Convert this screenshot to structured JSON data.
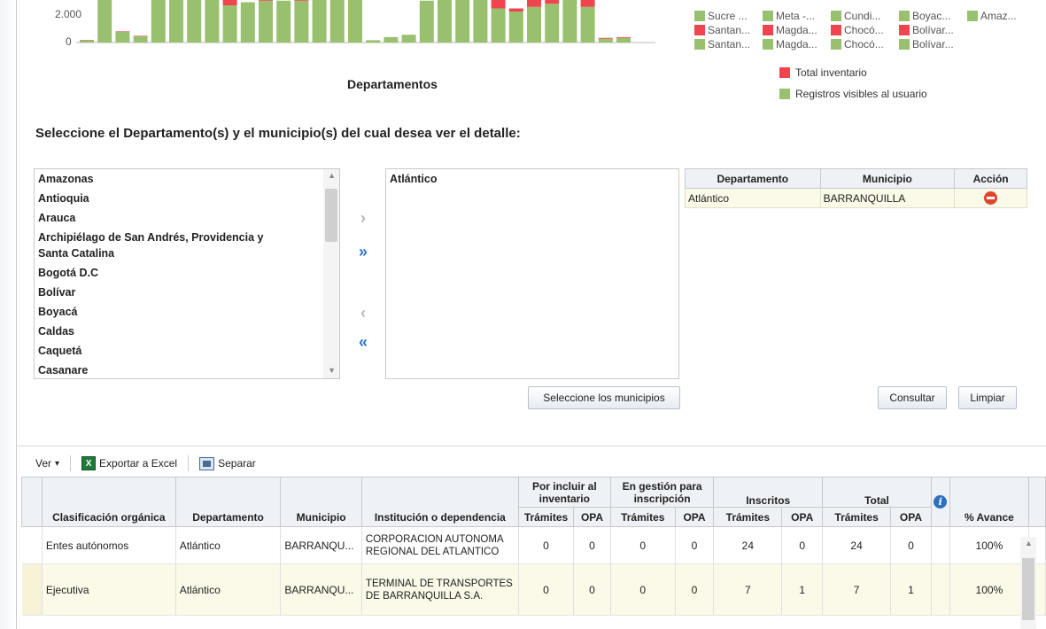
{
  "chart": {
    "y_ticks": [
      "2.000",
      "0"
    ],
    "x_title": "Departamentos",
    "legend_grid": [
      [
        "Sucre ...",
        "Meta -...",
        "Cundi...",
        "Boyac...",
        "Amaz..."
      ],
      [
        "Santan...",
        "Magda...",
        "Chocó...",
        "Bolívar..."
      ],
      [
        "Santan...",
        "Magda...",
        "Chocó...",
        "Bolívar..."
      ]
    ],
    "legend_grid_colors": [
      [
        "#99c06e",
        "#99c06e",
        "#99c06e",
        "#99c06e",
        "#99c06e"
      ],
      [
        "#f0444f",
        "#f0444f",
        "#f0444f",
        "#f0444f"
      ],
      [
        "#99c06e",
        "#99c06e",
        "#99c06e",
        "#99c06e"
      ]
    ],
    "legend_total": "Total inventario",
    "legend_visible": "Registros visibles al usuario",
    "colors": {
      "total": "#f0444f",
      "visible": "#99c06e"
    }
  },
  "chart_data": {
    "type": "bar",
    "title": "",
    "xlabel": "Departamentos",
    "ylabel": "",
    "ylim": [
      0,
      3000
    ],
    "y_ticks": [
      0,
      2000
    ],
    "note": "Stacked bars, top portion of chart is cropped; values estimated",
    "series": [
      {
        "name": "Registros visibles al usuario",
        "values": [
          150,
          3000,
          700,
          400,
          3000,
          3000,
          3000,
          3000,
          2400,
          2600,
          2700,
          2700,
          2700,
          2800,
          3000,
          2800,
          150,
          350,
          500,
          2700,
          3000,
          2900,
          3000,
          2200,
          2000,
          2300,
          2500,
          3000,
          2300,
          250,
          300
        ]
      },
      {
        "name": "Total inventario",
        "values": [
          20,
          0,
          30,
          30,
          0,
          0,
          700,
          0,
          600,
          0,
          400,
          0,
          600,
          600,
          600,
          800,
          0,
          0,
          0,
          0,
          400,
          0,
          400,
          700,
          200,
          600,
          600,
          0,
          800,
          50,
          50
        ]
      }
    ]
  },
  "labels": {
    "section_title": "Seleccione el Departamento(s) y el municipio(s) del cual desea ver el detalle:"
  },
  "available_list": [
    "Amazonas",
    "Antioquia",
    "Arauca",
    "Archipiélago de San Andrés, Providencia y",
    "Santa Catalina",
    "Bogotá D.C",
    "Bolívar",
    "Boyacá",
    "Caldas",
    "Caquetá",
    "Casanare"
  ],
  "selected_list": [
    "Atlántico"
  ],
  "shuttle": {
    "move": "›",
    "move_all": "»",
    "remove": "‹",
    "remove_all": "«"
  },
  "selection_table": {
    "headers": [
      "Departamento",
      "Municipio",
      "Acción"
    ],
    "rows": [
      {
        "departamento": "Atlántico",
        "municipio": "BARRANQUILLA"
      }
    ]
  },
  "buttons": {
    "select_municipios": "Seleccione los municipios",
    "consultar": "Consultar",
    "limpiar": "Limpiar"
  },
  "toolbar": {
    "ver": "Ver",
    "ver_caret": "▾",
    "export": "Exportar a Excel",
    "excel_glyph": "X",
    "detach": "Separar"
  },
  "grid": {
    "headers": {
      "clasificacion": "Clasificación orgánica",
      "departamento": "Departamento",
      "municipio": "Municipio",
      "institucion": "Institución o dependencia",
      "por_incluir": "Por incluir al inventario",
      "en_gestion": "En gestión para inscripción",
      "inscritos": "Inscritos",
      "total": "Total",
      "info": "i",
      "avance": "% Avance",
      "tramites": "Trámites",
      "opa": "OPA"
    },
    "rows": [
      {
        "clasificacion": "Entes autónomos",
        "departamento": "Atlántico",
        "municipio": "BARRANQU...",
        "institucion": "CORPORACION AUTONOMA REGIONAL DEL ATLANTICO",
        "pi_tramites": "0",
        "pi_opa": "0",
        "eg_tramites": "0",
        "eg_opa": "0",
        "in_tramites": "24",
        "in_opa": "0",
        "to_tramites": "24",
        "to_opa": "0",
        "avance": "100%"
      },
      {
        "clasificacion": "Ejecutiva",
        "departamento": "Atlántico",
        "municipio": "BARRANQU...",
        "institucion": "TERMINAL DE TRANSPORTES DE BARRANQUILLA S.A.",
        "pi_tramites": "0",
        "pi_opa": "0",
        "eg_tramites": "0",
        "eg_opa": "0",
        "in_tramites": "7",
        "in_opa": "1",
        "to_tramites": "7",
        "to_opa": "1",
        "avance": "100%"
      }
    ]
  }
}
